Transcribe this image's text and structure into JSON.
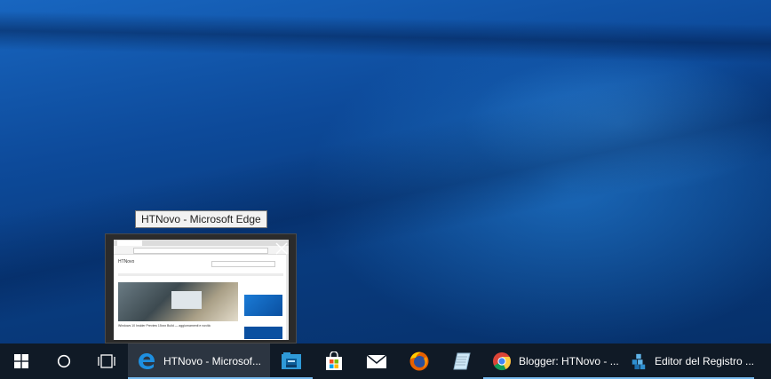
{
  "tooltip": {
    "text": "HTNovo - Microsoft Edge"
  },
  "preview": {
    "site_brand": "HTNovo",
    "headline": "Windows 10 Insider Preview 15xxx Build — aggiornamenti e novità"
  },
  "taskbar": {
    "buttons": [
      {
        "name": "start",
        "icon": "windows-logo-icon"
      },
      {
        "name": "cortana",
        "icon": "circle-icon"
      },
      {
        "name": "task-view",
        "icon": "task-view-icon"
      }
    ],
    "apps": [
      {
        "label": "HTNovo - Microsof...",
        "icon": "edge-icon",
        "active": true
      },
      {
        "label": "",
        "icon": "file-explorer-icon"
      },
      {
        "label": "",
        "icon": "store-icon"
      },
      {
        "label": "",
        "icon": "mail-icon"
      },
      {
        "label": "",
        "icon": "firefox-icon"
      },
      {
        "label": "",
        "icon": "notepad-icon"
      },
      {
        "label": "Blogger: HTNovo - ...",
        "icon": "chrome-icon"
      },
      {
        "label": "Editor del Registro ...",
        "icon": "registry-editor-icon"
      }
    ]
  },
  "colors": {
    "accent": "#76b9ed",
    "taskbar": "#101a26",
    "active_tab": "#2c3541"
  }
}
